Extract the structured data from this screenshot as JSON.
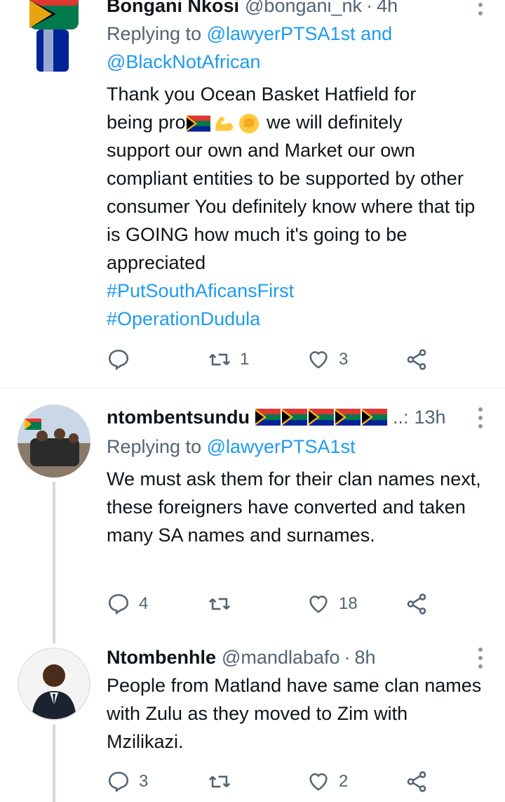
{
  "tweets": [
    {
      "name": "Bongani Nkosi",
      "handle": "@bongani_nk",
      "dot": "·",
      "time": "4h",
      "reply_prefix": "Replying to",
      "reply_handles": [
        "@lawyerPTSA1st",
        "and",
        "@BlackNotAfrican"
      ],
      "text_line1": "Thank you Ocean Basket Hatfield for",
      "text_line2a": "being pro",
      "text_line2b": "we will definitely",
      "text_rest": "support our own and Market our own compliant entities to be supported by other consumer You definitely know where that tip is GOING how much it's going to be appreciated",
      "hashtags": [
        "#PutSouthAficansFirst",
        "#OperationDudula"
      ],
      "actions": {
        "replies": "",
        "retweets": "1",
        "likes": "3"
      },
      "avatar_icon": "fist-flag-avatar"
    },
    {
      "name": "ntombentsundu",
      "handle": "",
      "dot": "",
      "time": "13h",
      "name_suffix": "..:",
      "reply_prefix": "Replying to",
      "reply_handles": [
        "@lawyerPTSA1st"
      ],
      "text": "We must ask them for their clan names next, these foreigners have converted and taken many SA names and surnames.",
      "actions": {
        "replies": "4",
        "retweets": "",
        "likes": "18"
      },
      "avatar_icon": "crowd-photo-avatar"
    },
    {
      "name": "Ntombenhle",
      "handle": "@mandlabafo",
      "dot": "·",
      "time": "8h",
      "text": "People from Matland have same clan names with Zulu as they moved to Zim with Mzilikazi.",
      "actions": {
        "replies": "3",
        "retweets": "",
        "likes": "2"
      },
      "avatar_icon": "man-in-suit-avatar"
    }
  ],
  "colors": {
    "link": "#1d9bf0",
    "muted": "#536471",
    "text": "#0f1419"
  },
  "icons": [
    "reply-icon",
    "retweet-icon",
    "like-icon",
    "share-icon",
    "more-icon",
    "south-africa-flag-icon"
  ]
}
